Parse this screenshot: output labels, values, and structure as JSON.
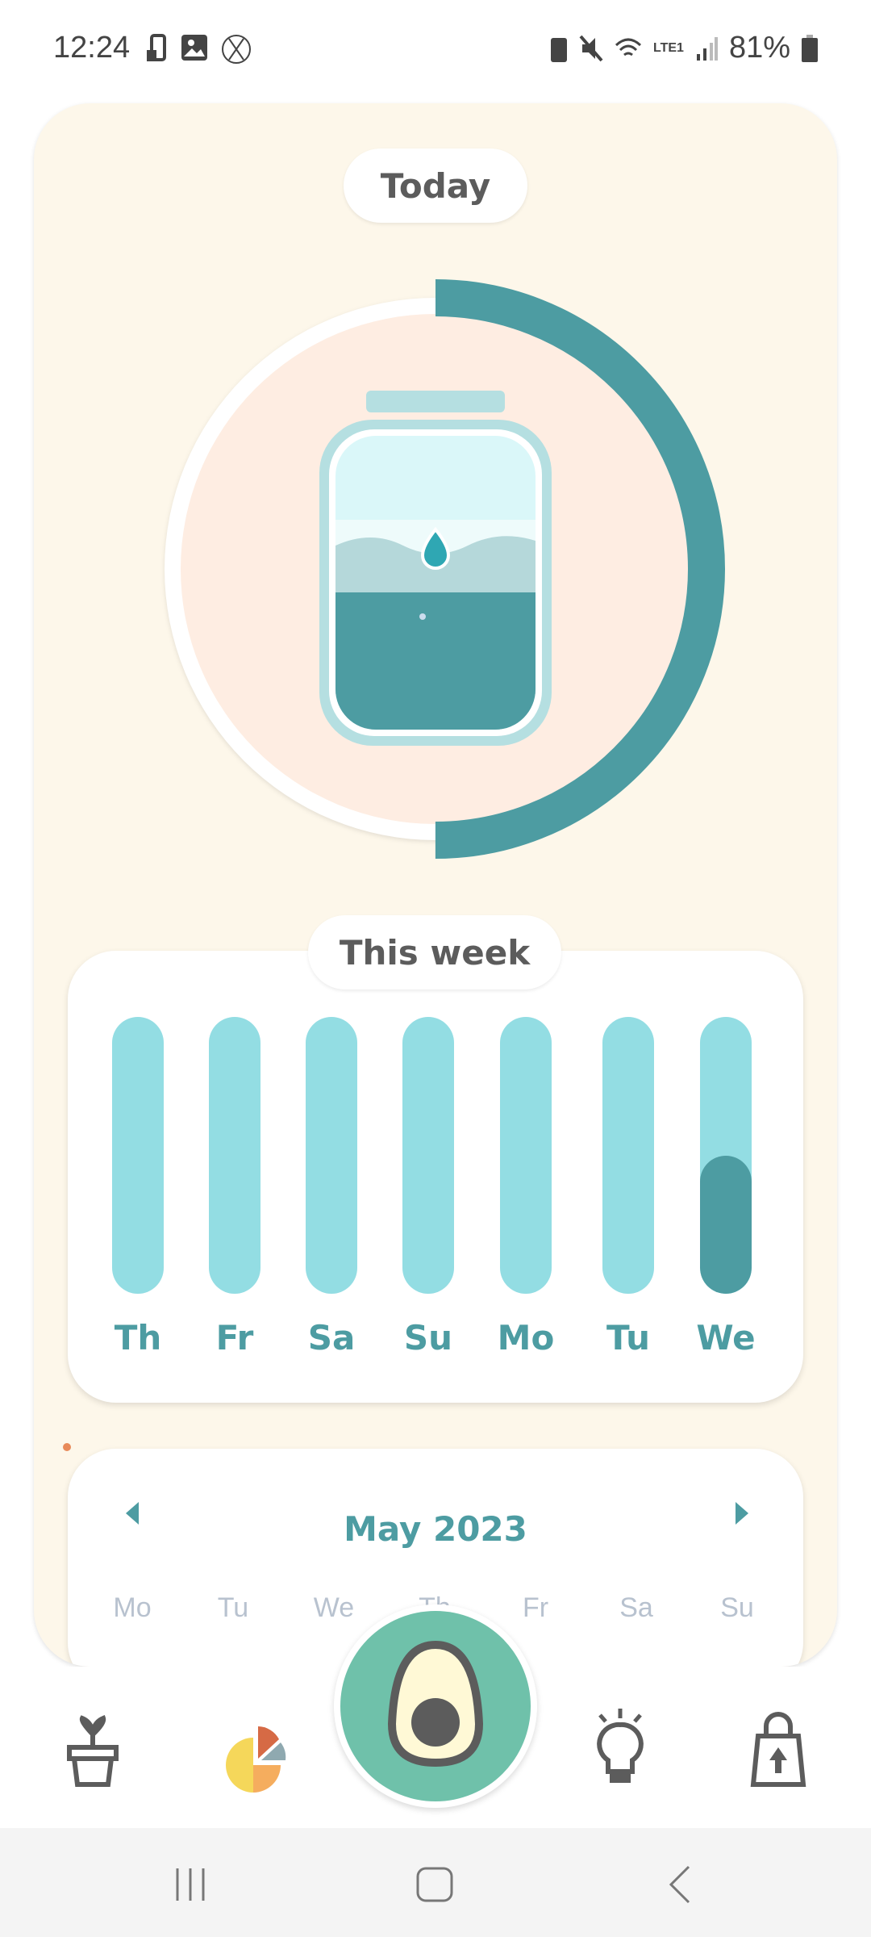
{
  "status_bar": {
    "time": "12:24",
    "network": "LTE1",
    "battery": "81%"
  },
  "today": {
    "label": "Today",
    "progress_percent": 50
  },
  "week": {
    "label": "This week",
    "days": [
      {
        "label": "Th",
        "fill": 0
      },
      {
        "label": "Fr",
        "fill": 0
      },
      {
        "label": "Sa",
        "fill": 0
      },
      {
        "label": "Su",
        "fill": 0
      },
      {
        "label": "Mo",
        "fill": 0
      },
      {
        "label": "Tu",
        "fill": 0
      },
      {
        "label": "We",
        "fill": 0.5
      }
    ]
  },
  "calendar": {
    "title": "May 2023",
    "weekdays": [
      "Mo",
      "Tu",
      "We",
      "Th",
      "Fr",
      "Sa",
      "Su"
    ]
  },
  "colors": {
    "accent": "#4d9ca2",
    "bar_bg": "#93dde3",
    "card_bg": "#fdf7ea",
    "fab": "#6fc1aa"
  }
}
